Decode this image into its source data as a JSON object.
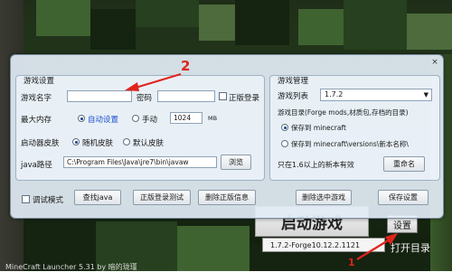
{
  "colors": {
    "accent": "#1d4fd1",
    "annotation_red": "#e0241c",
    "dialog_bg": "#e1ebf4"
  },
  "dialog": {
    "close_icon": "×",
    "game_settings": {
      "title": "游戏设置",
      "name_label": "游戏名字",
      "name_value": "",
      "password_label": "密码",
      "password_value": "",
      "official_login_label": "正版登录",
      "official_login_checked": false,
      "memory_label": "最大内存",
      "memory_auto_label": "自动设置",
      "memory_manual_label": "手动",
      "memory_value": "1024",
      "memory_unit": "MB",
      "memory_mode": "auto",
      "skin_label": "启动器皮肤",
      "skin_random_label": "随机皮肤",
      "skin_default_label": "默认皮肤",
      "skin_mode": "random",
      "java_path_label": "java路径",
      "java_path_value": "C:\\Program Files\\Java\\jre7\\bin\\javaw",
      "browse_label": "浏览"
    },
    "game_management": {
      "title": "游戏管理",
      "list_label": "游戏列表",
      "list_value": "1.7.2",
      "dir_label": "游戏目录(Forge mods,材质包,存档的目录)",
      "save_to_minecraft": "保存到 minecraft",
      "save_to_versions": "保存到 minecraft\\versions\\新本名称\\",
      "dir_mode": "minecraft",
      "note": "只在1.6以上的新本有效",
      "rename_label": "重命名"
    },
    "bottom": {
      "debug_label": "调试模式",
      "debug_checked": false,
      "find_java_label": "查找java",
      "test_login_label": "正版登录测试",
      "delete_info_label": "删除正版信息",
      "delete_selected_label": "删除选中游戏",
      "save_settings_label": "保存设置"
    }
  },
  "launcher": {
    "banner_text": "启动游戏",
    "settings_label": "设置",
    "version_value": "1.7.2-Forge10.12.2.1121",
    "open_dir_label": "打开目录",
    "status_text": "MineCraft Launcher 5.31 by 暗的珑瑾"
  },
  "annotations": {
    "one": "1",
    "two": "2"
  }
}
